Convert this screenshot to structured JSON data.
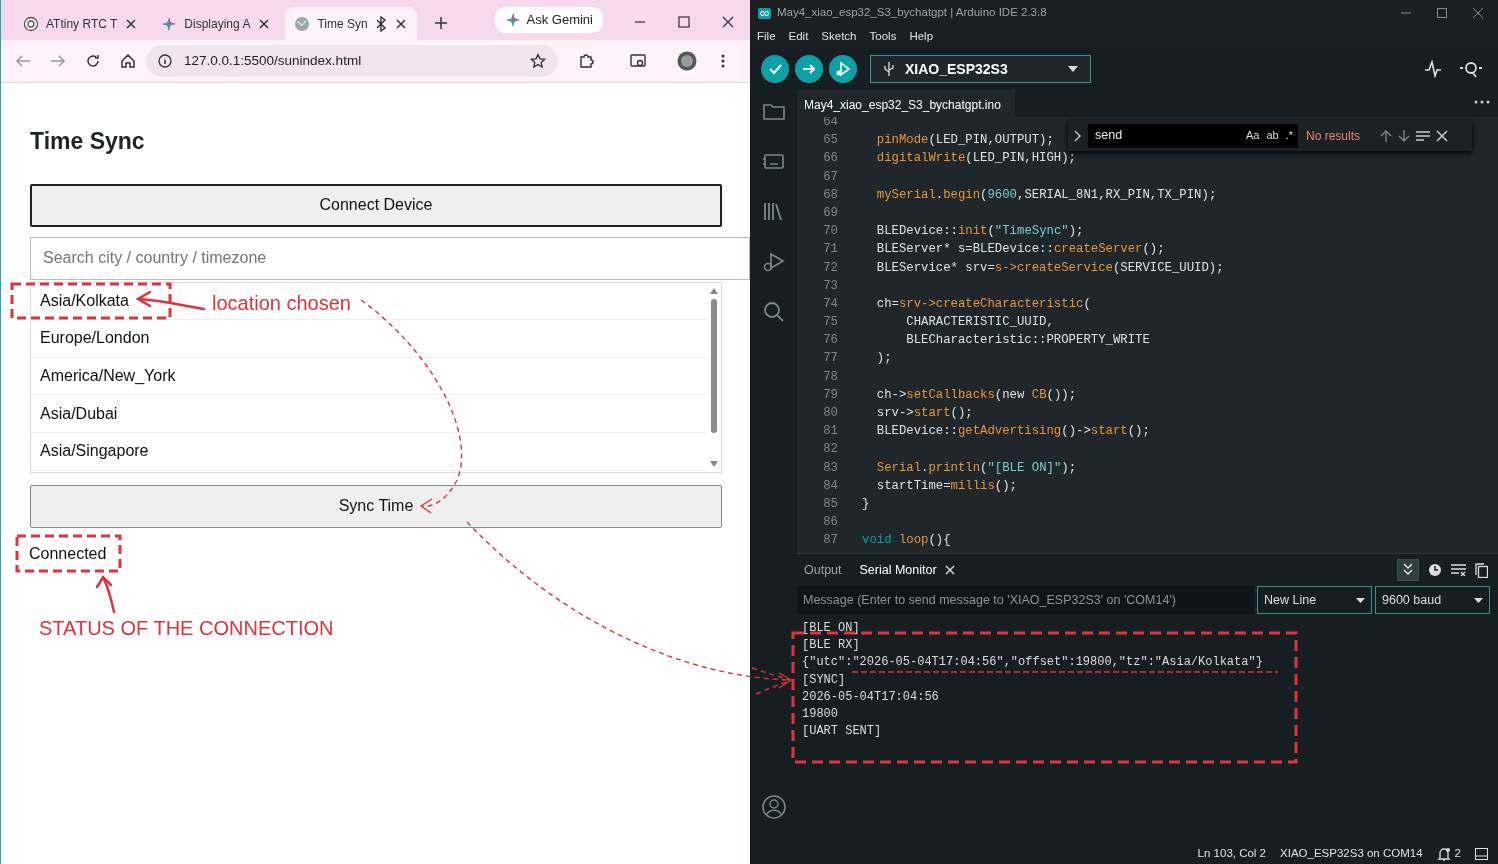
{
  "browser": {
    "tabs": [
      {
        "title": "ATtiny RTC T",
        "selected": false,
        "bluetooth": false
      },
      {
        "title": "Displaying A",
        "selected": false,
        "bluetooth": false
      },
      {
        "title": "Time Syn",
        "selected": true,
        "bluetooth": true
      }
    ],
    "ask_button": "Ask Gemini",
    "address": "127.0.0.1:5500/sunindex.html",
    "page": {
      "title": "Time Sync",
      "connect_button": "Connect Device",
      "search": {
        "placeholder": "Search city / country / timezone"
      },
      "timezones": [
        "Asia/Kolkata",
        "Europe/London",
        "America/New_York",
        "Asia/Dubai",
        "Asia/Singapore"
      ],
      "sync_button": "Sync Time",
      "status": "Connected"
    }
  },
  "annotations": [
    {
      "text": "location chosen"
    },
    {
      "text": "STATUS OF THE CONNECTION"
    }
  ],
  "ide": {
    "title": "May4_xiao_esp32_S3_bychatgpt | Arduino IDE 2.3.8",
    "menu": [
      "File",
      "Edit",
      "Sketch",
      "Tools",
      "Help"
    ],
    "board": "XIAO_ESP32S3",
    "file_tab": "May4_xiao_esp32_S3_bychatgpt.ino",
    "find": {
      "value": "send",
      "options": [
        "Aa",
        "ab",
        ".*"
      ],
      "result": "No results"
    },
    "code": [
      {
        "number": "64"
      },
      {
        "number": "65",
        "tokens": [
          {
            "text": "  pinMode",
            "kind": "func"
          },
          {
            "text": "(LED_PIN,OUTPUT);",
            "kind": "plain"
          }
        ]
      },
      {
        "number": "66",
        "tokens": [
          {
            "text": "  digitalWrite",
            "kind": "func"
          },
          {
            "text": "(LED_PIN,HIGH);",
            "kind": "plain"
          }
        ]
      },
      {
        "number": "67"
      },
      {
        "number": "68",
        "tokens": [
          {
            "text": "  mySerial",
            "kind": "func"
          },
          {
            "text": ".",
            "kind": "plain"
          },
          {
            "text": "begin",
            "kind": "func"
          },
          {
            "text": "(",
            "kind": "plain"
          },
          {
            "text": "9600",
            "kind": "literal"
          },
          {
            "text": ",SERIAL_8N1,RX_PIN,TX_PIN);",
            "kind": "plain"
          }
        ]
      },
      {
        "number": "69"
      },
      {
        "number": "70",
        "tokens": [
          {
            "text": "  BLEDevice::",
            "kind": "plain"
          },
          {
            "text": "init",
            "kind": "func"
          },
          {
            "text": "(",
            "kind": "plain"
          },
          {
            "text": "\"TimeSync\"",
            "kind": "literal"
          },
          {
            "text": ");",
            "kind": "plain"
          }
        ]
      },
      {
        "number": "71",
        "tokens": [
          {
            "text": "  BLEServer* s=BLEDevice::",
            "kind": "plain"
          },
          {
            "text": "createServer",
            "kind": "func"
          },
          {
            "text": "();",
            "kind": "plain"
          }
        ]
      },
      {
        "number": "72",
        "tokens": [
          {
            "text": "  BLEService* srv=",
            "kind": "plain"
          },
          {
            "text": "s->createService",
            "kind": "func"
          },
          {
            "text": "(SERVICE_UUID);",
            "kind": "plain"
          }
        ]
      },
      {
        "number": "73"
      },
      {
        "number": "74",
        "tokens": [
          {
            "text": "  ch=",
            "kind": "plain"
          },
          {
            "text": "srv->createCharacteristic",
            "kind": "func"
          },
          {
            "text": "(",
            "kind": "plain"
          }
        ]
      },
      {
        "number": "75",
        "tokens": [
          {
            "text": "      CHARACTERISTIC_UUID,",
            "kind": "plain"
          }
        ]
      },
      {
        "number": "76",
        "tokens": [
          {
            "text": "      BLECharacteristic::PROPERTY_WRITE",
            "kind": "plain"
          }
        ]
      },
      {
        "number": "77",
        "tokens": [
          {
            "text": "  );",
            "kind": "plain"
          }
        ]
      },
      {
        "number": "78"
      },
      {
        "number": "79",
        "tokens": [
          {
            "text": "  ch->",
            "kind": "plain"
          },
          {
            "text": "setCallbacks",
            "kind": "func"
          },
          {
            "text": "(new ",
            "kind": "plain"
          },
          {
            "text": "CB",
            "kind": "func"
          },
          {
            "text": "());",
            "kind": "plain"
          }
        ]
      },
      {
        "number": "80",
        "tokens": [
          {
            "text": "  srv->",
            "kind": "plain"
          },
          {
            "text": "start",
            "kind": "func"
          },
          {
            "text": "();",
            "kind": "plain"
          }
        ]
      },
      {
        "number": "81",
        "tokens": [
          {
            "text": "  BLEDevice::",
            "kind": "plain"
          },
          {
            "text": "getAdvertising",
            "kind": "func"
          },
          {
            "text": "()->",
            "kind": "plain"
          },
          {
            "text": "start",
            "kind": "func"
          },
          {
            "text": "();",
            "kind": "plain"
          }
        ]
      },
      {
        "number": "82"
      },
      {
        "number": "83",
        "tokens": [
          {
            "text": "  Serial",
            "kind": "func"
          },
          {
            "text": ".",
            "kind": "plain"
          },
          {
            "text": "println",
            "kind": "func"
          },
          {
            "text": "(",
            "kind": "plain"
          },
          {
            "text": "\"[BLE ON]\"",
            "kind": "literal"
          },
          {
            "text": ");",
            "kind": "plain"
          }
        ]
      },
      {
        "number": "84",
        "tokens": [
          {
            "text": "  startTime=",
            "kind": "plain"
          },
          {
            "text": "millis",
            "kind": "func"
          },
          {
            "text": "();",
            "kind": "plain"
          }
        ]
      },
      {
        "number": "85",
        "tokens": [
          {
            "text": "}",
            "kind": "plain"
          }
        ]
      },
      {
        "number": "86"
      },
      {
        "number": "87",
        "tokens": [
          {
            "text": "void",
            "kind": "keyword"
          },
          {
            "text": " loop",
            "kind": "func"
          },
          {
            "text": "(){",
            "kind": "plain"
          }
        ]
      }
    ],
    "panel_tabs": [
      {
        "label": "Output",
        "selected": false,
        "closable": false
      },
      {
        "label": "Serial Monitor",
        "selected": true,
        "closable": true
      }
    ],
    "message": {
      "placeholder": "Message (Enter to send message to 'XIAO_ESP32S3' on 'COM14')"
    },
    "line_ending": "New Line",
    "baud": "9600 baud",
    "serial_output": [
      "[BLE ON]",
      "[BLE RX]",
      "{\"utc\":\"2026-05-04T17:04:56\",\"offset\":19800,\"tz\":\"Asia/Kolkata\"}",
      "[SYNC]",
      "2026-05-04T17:04:56",
      "19800",
      "[UART SENT]"
    ],
    "status_bar": {
      "position": "Ln 103, Col 2",
      "board": "XIAO_ESP32S3 on COM14",
      "notifications": "2"
    }
  }
}
